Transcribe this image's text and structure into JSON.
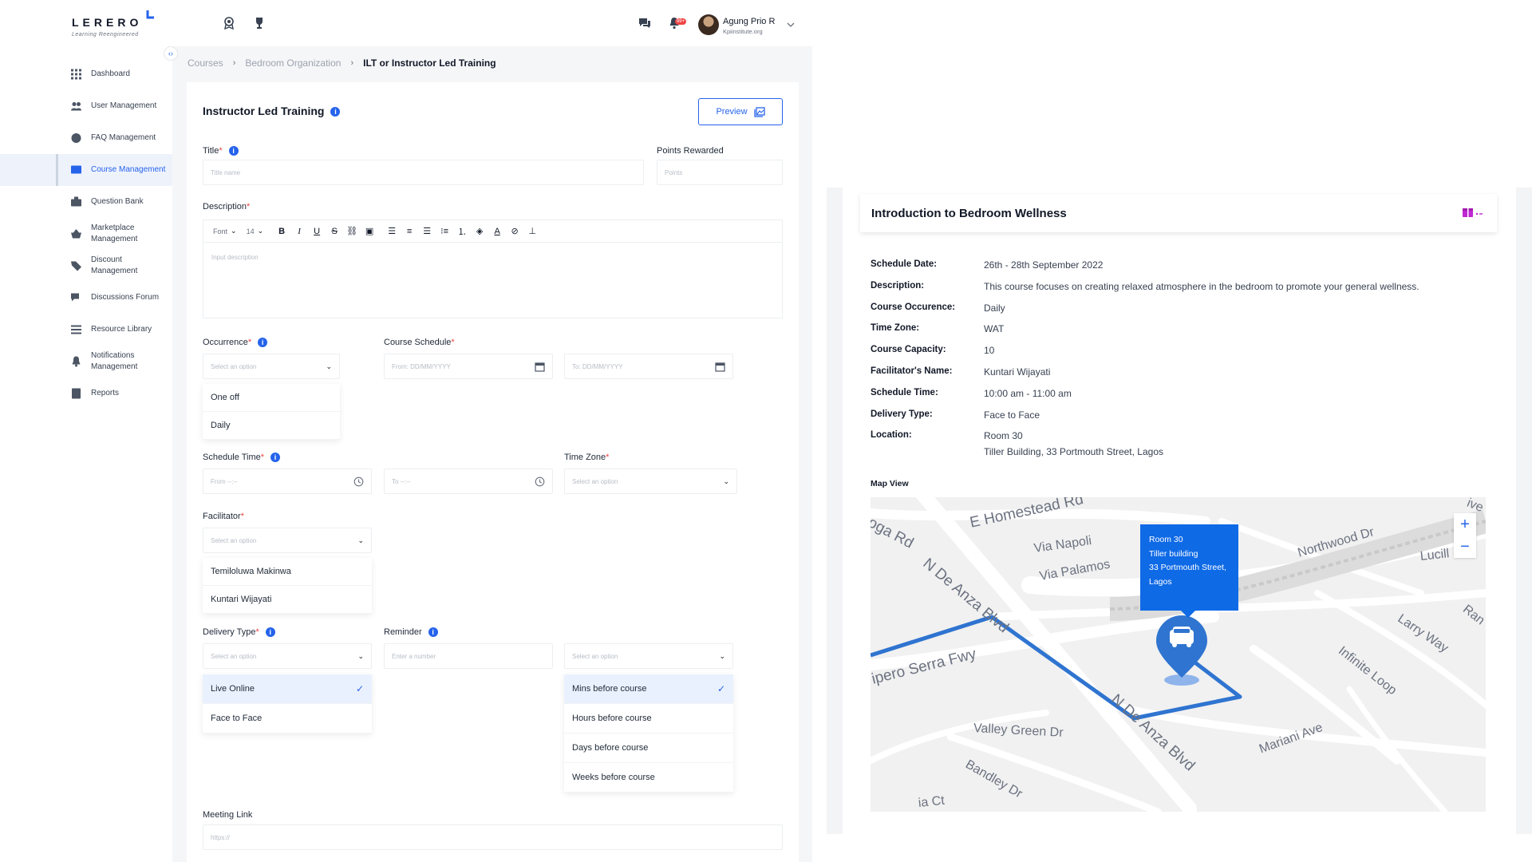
{
  "brand": {
    "name": "LERERO",
    "tagline": "Learning Reengineered"
  },
  "user": {
    "name": "Agung Prio R",
    "org": "Kpiinstitute.org",
    "notif_count": "99+"
  },
  "sidebar": {
    "items": [
      {
        "label": "Dashboard",
        "icon": "grid-icon"
      },
      {
        "label": "User Management",
        "icon": "users-icon"
      },
      {
        "label": "FAQ Management",
        "icon": "help-circle-icon"
      },
      {
        "label": "Course Management",
        "icon": "course-icon",
        "active": true
      },
      {
        "label": "Question Bank",
        "icon": "briefcase-icon"
      },
      {
        "label": "Marketplace\nManagement",
        "icon": "basket-icon"
      },
      {
        "label": "Discount\nManagement",
        "icon": "tag-icon"
      },
      {
        "label": "Discussions Forum",
        "icon": "chat-icon"
      },
      {
        "label": "Resource Library",
        "icon": "list-icon"
      },
      {
        "label": "Notifications\nManagement",
        "icon": "bell-icon"
      },
      {
        "label": "Reports",
        "icon": "report-icon"
      }
    ]
  },
  "breadcrumb": {
    "c1": "Courses",
    "c2": "Bedroom Organization",
    "c3": "ILT or Instructor Led Training"
  },
  "form": {
    "heading": "Instructor Led Training",
    "preview": "Preview",
    "title_label": "Title",
    "title_ph": "Title name",
    "points_label": "Points Rewarded",
    "points_ph": "Points",
    "desc_label": "Description",
    "font_sel": "Font",
    "size_sel": "14",
    "desc_ph": "Input description",
    "occurrence_label": "Occurrence",
    "select_ph": "Select an option",
    "occurrence_options": [
      "One off",
      "Daily"
    ],
    "schedule_label": "Course Schedule",
    "from_date_ph": "From: DD/MM/YYYY",
    "to_date_ph": "To: DD/MM/YYYY",
    "time_label": "Schedule Time",
    "from_time_ph": "From --:--",
    "to_time_ph": "To --:--",
    "tz_label": "Time Zone",
    "facilitator_label": "Facilitator",
    "facilitator_options": [
      "Temiloluwa Makinwa",
      "Kuntari Wijayati"
    ],
    "delivery_label": "Delivery Type",
    "delivery_options": [
      "Live Online",
      "Face to Face"
    ],
    "reminder_label": "Reminder",
    "reminder_ph": "Enter a number",
    "reminder_options": [
      "Mins before course",
      "Hours before course",
      "Days before course",
      "Weeks before course"
    ],
    "meeting_label": "Meeting Link",
    "meeting_ph": "https://"
  },
  "detail": {
    "title": "Introduction to Bedroom Wellness",
    "rows": [
      {
        "k": "Schedule Date:",
        "v": "26th - 28th September 2022"
      },
      {
        "k": "Description:",
        "v": "This course focuses on creating relaxed atmosphere in the bedroom to promote your general wellness."
      },
      {
        "k": "Course Occurence:",
        "v": "Daily"
      },
      {
        "k": "Time Zone:",
        "v": "WAT"
      },
      {
        "k": "Course Capacity:",
        "v": "10"
      },
      {
        "k": "Facilitator's Name:",
        "v": "Kuntari Wijayati"
      },
      {
        "k": "Schedule Time:",
        "v": "10:00 am - 11:00 am"
      },
      {
        "k": "Delivery Type:",
        "v": "Face to Face"
      }
    ],
    "location_k": "Location:",
    "location_v1": "Room 30",
    "location_v2": "Tiller Building, 33 Portmouth Street, Lagos",
    "map_label": "Map View"
  },
  "map": {
    "popup": [
      "Room 30",
      "Tiller building",
      "33 Portmouth Street,",
      "Lagos"
    ],
    "roads": [
      "oga Rd",
      "E Homestead Rd",
      "Via Napoli",
      "Via Palamos",
      "N De Anza Blvd",
      "Northwood Dr",
      "Lucill",
      "ive",
      "Ran",
      "Larry Way",
      "Infinite Loop",
      "ipero Serra Fwy",
      "N De Anza Blvd",
      "Valley Green Dr",
      "Mariani Ave",
      "Bandley Dr",
      "ia Ct"
    ],
    "zoom_in": "+",
    "zoom_out": "−"
  },
  "colors": {
    "accent": "#2563eb",
    "route": "#2f74d0",
    "popup": "#0f6ae6"
  }
}
